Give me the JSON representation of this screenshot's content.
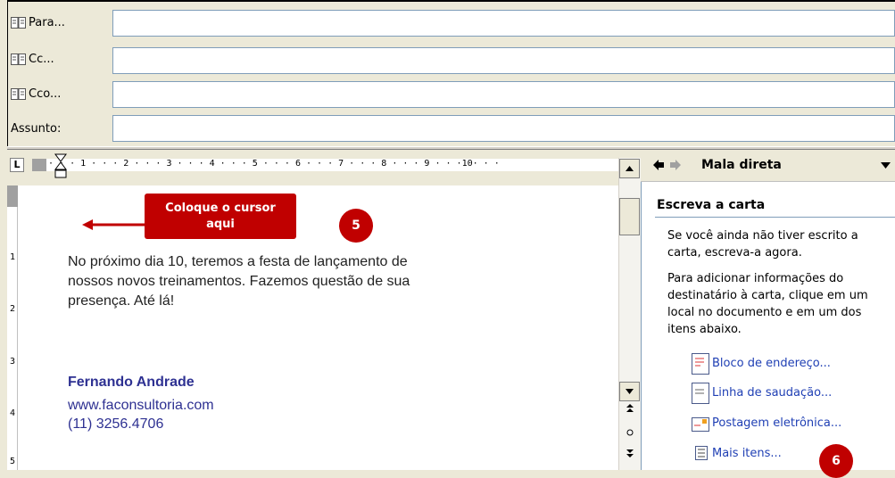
{
  "header": {
    "to_label": "Para...",
    "cc_label": "Cc...",
    "bcc_label": "Cco...",
    "subject_label": "Assunto:"
  },
  "ruler": {
    "corner": "L",
    "marks": "· · · 1 · · · 2 · · · 3 · · · 4 · · · 5 · · · 6 · · · 7 · · · 8 · · · 9 · · ·10· · ·",
    "v_numbers": [
      "1",
      "2",
      "3",
      "4",
      "5"
    ]
  },
  "document": {
    "body_lines": [
      "No próximo dia 10, teremos a festa de lançamento de",
      "nossos novos treinamentos. Fazemos questão de sua",
      "presença. Até lá!"
    ],
    "signature_name": "Fernando Andrade",
    "signature_site": "www.faconsultoria.com",
    "signature_phone": "(11) 3256.4706"
  },
  "callout": {
    "line1": "Coloque o cursor",
    "line2": "aqui",
    "step5": "5",
    "step6": "6"
  },
  "task_pane": {
    "title": "Mala direta",
    "section": "Escreva a carta",
    "para1": "Se você ainda não tiver escrito a carta, escreva-a agora.",
    "para2": "Para adicionar informações do destinatário à carta, clique em um local no documento e em um dos itens abaixo.",
    "links": [
      "Bloco de endereço...",
      "Linha de saudação...",
      "Postagem eletrônica...",
      "Mais itens..."
    ]
  },
  "colors": {
    "callout": "#c00000",
    "link": "#1f3fb4",
    "signature": "#2e3192"
  }
}
